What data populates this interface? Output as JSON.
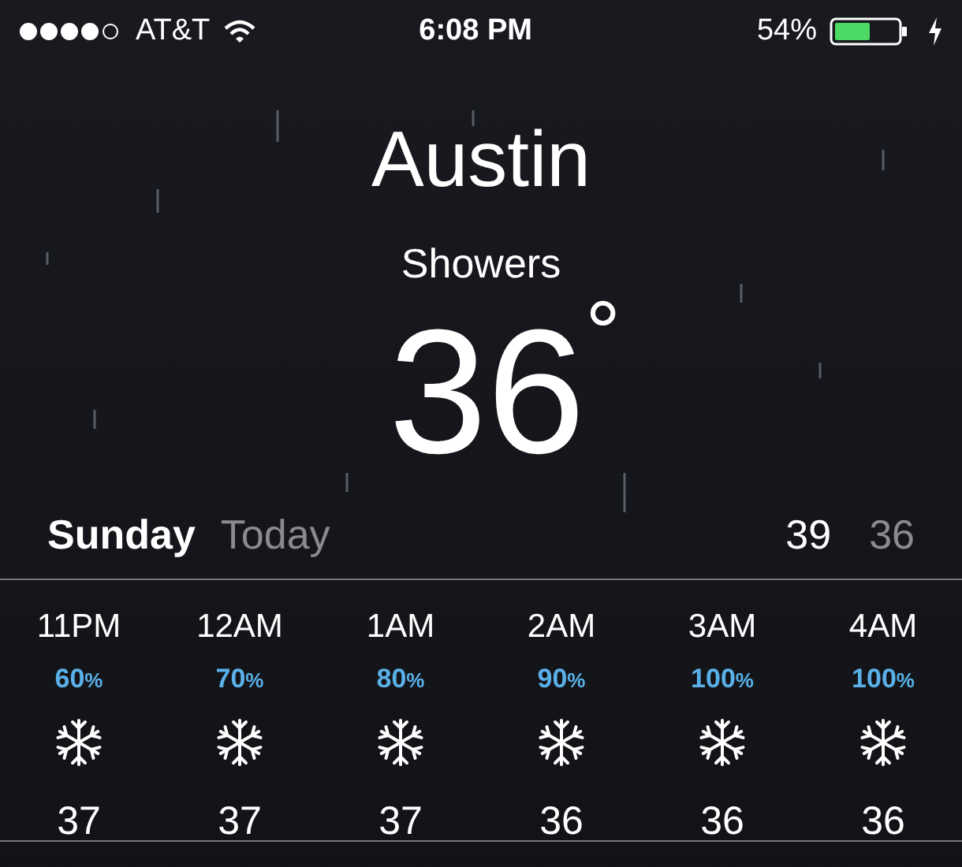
{
  "status_bar": {
    "carrier": "AT&T",
    "time": "6:08 PM",
    "battery": "54%"
  },
  "location": {
    "city": "Austin",
    "condition": "Showers",
    "temperature": "36",
    "degree": "°"
  },
  "day_row": {
    "day": "Sunday",
    "label": "Today",
    "high": "39",
    "low": "36"
  },
  "hourly": [
    {
      "time": "11PM",
      "chance": "60",
      "unit": "%",
      "kind": "snow",
      "temp": "37"
    },
    {
      "time": "12AM",
      "chance": "70",
      "unit": "%",
      "kind": "snow",
      "temp": "37"
    },
    {
      "time": "1AM",
      "chance": "80",
      "unit": "%",
      "kind": "snow",
      "temp": "37"
    },
    {
      "time": "2AM",
      "chance": "90",
      "unit": "%",
      "kind": "snow",
      "temp": "36"
    },
    {
      "time": "3AM",
      "chance": "100",
      "unit": "%",
      "kind": "snow",
      "temp": "36"
    },
    {
      "time": "4AM",
      "chance": "100",
      "unit": "%",
      "kind": "snow",
      "temp": "36"
    }
  ]
}
